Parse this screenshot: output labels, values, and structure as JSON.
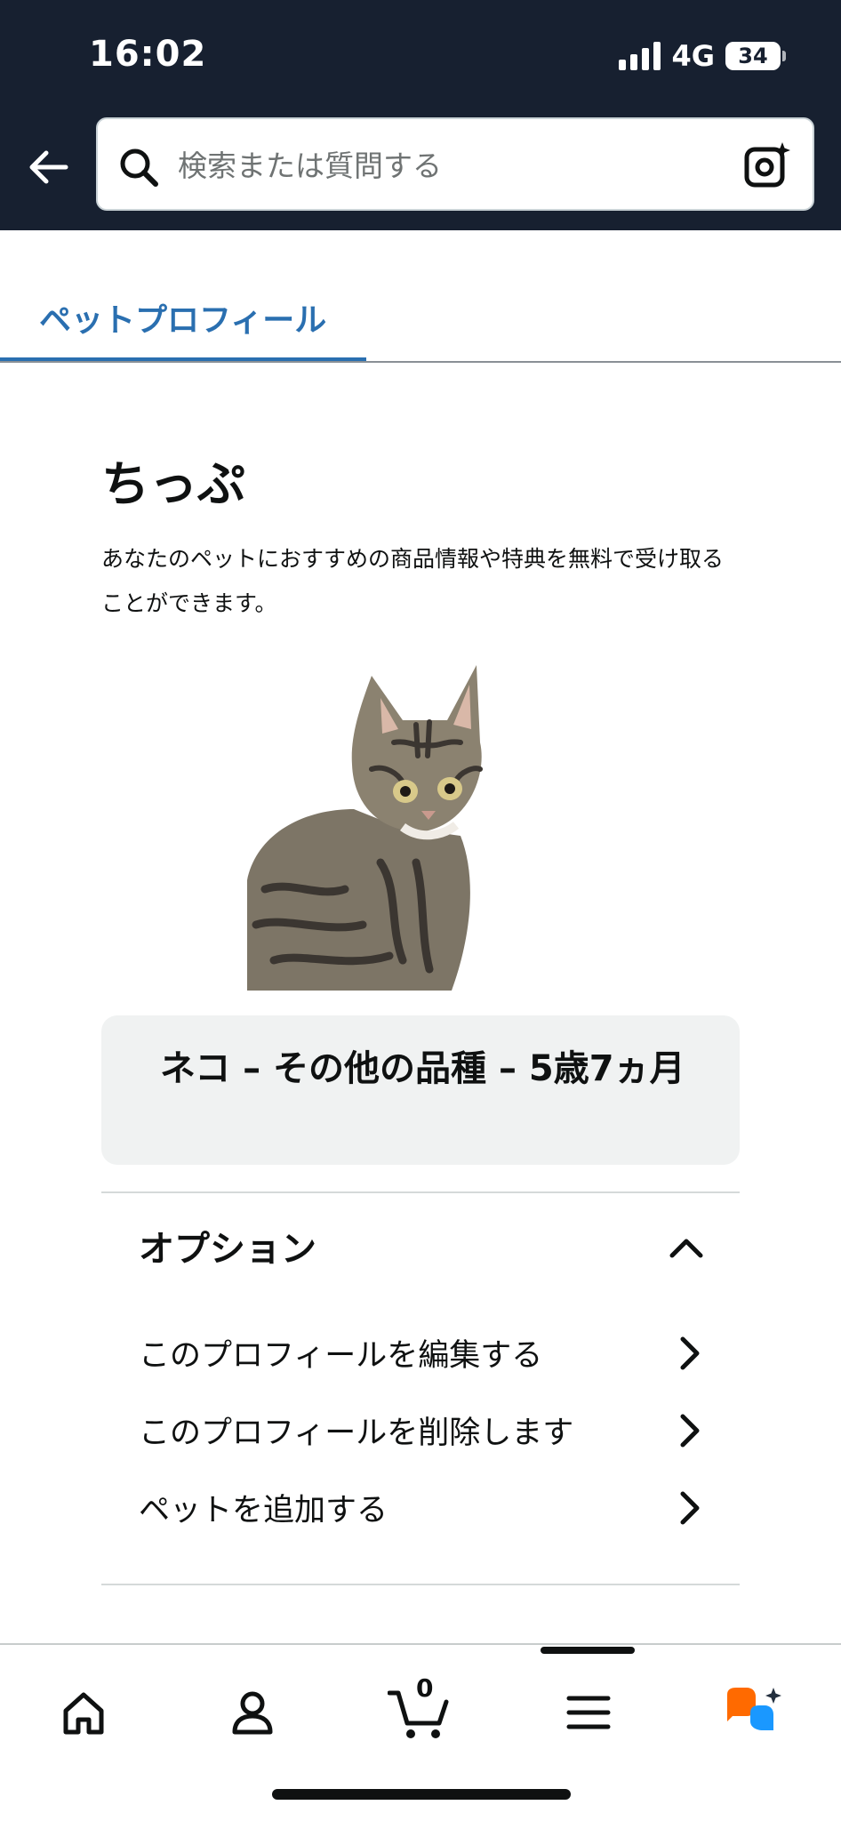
{
  "status_bar": {
    "time": "16:02",
    "network": "4G",
    "battery": "34"
  },
  "search": {
    "placeholder": "検索または質問する"
  },
  "tabs": [
    {
      "label": "ペットプロフィール",
      "active": true
    }
  ],
  "pet": {
    "name": "ちっぷ",
    "description": "あなたのペットにおすすめの商品情報や特典を無料で受け取ることができます。",
    "image_alt": "cat-photo",
    "info": "ネコ – その他の品種 – 5歳7ヵ月"
  },
  "options": {
    "title": "オプション",
    "items": [
      {
        "label": "このプロフィールを編集する"
      },
      {
        "label": "このプロフィールを削除します"
      },
      {
        "label": "ペットを追加する"
      }
    ]
  },
  "bottom_nav": {
    "items": [
      {
        "icon": "home-icon"
      },
      {
        "icon": "account-icon"
      },
      {
        "icon": "cart-icon",
        "count": "0"
      },
      {
        "icon": "menu-icon"
      },
      {
        "icon": "rufus-ai-icon"
      }
    ]
  },
  "colors": {
    "header_bg": "#172030",
    "accent": "#2a6fb0",
    "card_bg": "#f0f2f2"
  }
}
